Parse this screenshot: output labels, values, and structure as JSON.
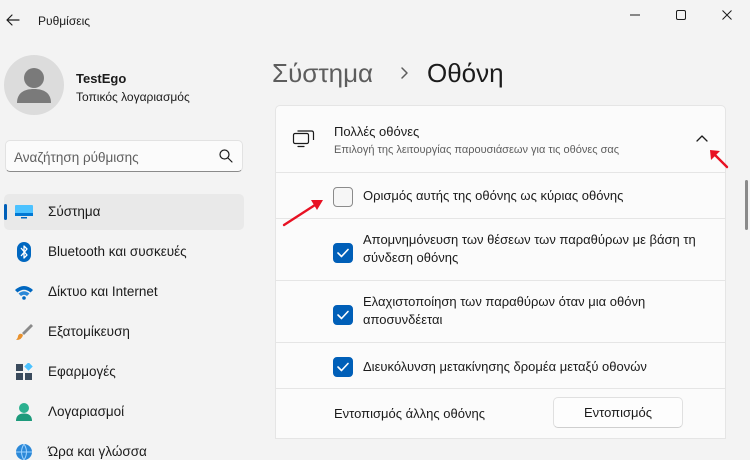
{
  "window": {
    "title": "Ρυθμίσεις"
  },
  "profile": {
    "name": "TestEgo",
    "account_type": "Τοπικός λογαριασμός"
  },
  "search": {
    "placeholder": "Αναζήτηση ρύθμισης"
  },
  "nav": {
    "items": [
      {
        "label": "Σύστημα",
        "icon": "system-monitor-icon",
        "selected": true
      },
      {
        "label": "Bluetooth και συσκευές",
        "icon": "bluetooth-icon",
        "selected": false
      },
      {
        "label": "Δίκτυο και Internet",
        "icon": "wifi-icon",
        "selected": false
      },
      {
        "label": "Εξατομίκευση",
        "icon": "paintbrush-icon",
        "selected": false
      },
      {
        "label": "Εφαρμογές",
        "icon": "apps-icon",
        "selected": false
      },
      {
        "label": "Λογαριασμοί",
        "icon": "account-icon",
        "selected": false
      },
      {
        "label": "Ώρα και γλώσσα",
        "icon": "globe-clock-icon",
        "selected": false
      }
    ]
  },
  "breadcrumb": {
    "parent": "Σύστημα",
    "current": "Οθόνη"
  },
  "multiple_displays": {
    "title": "Πολλές οθόνες",
    "subtitle": "Επιλογή της λειτουργίας παρουσιάσεων για τις οθόνες σας",
    "expanded": true,
    "options": [
      {
        "label": "Ορισμός αυτής της οθόνης ως κύριας οθόνης",
        "checked": false
      },
      {
        "label": "Απομνημόνευση των θέσεων των παραθύρων με βάση τη σύνδεση οθόνης",
        "checked": true
      },
      {
        "label": "Ελαχιστοποίηση των παραθύρων όταν μια οθόνη αποσυνδέεται",
        "checked": true
      },
      {
        "label": "Διευκόλυνση μετακίνησης δρομέα μεταξύ οθονών",
        "checked": true
      }
    ],
    "detect": {
      "label": "Εντοπισμός άλλης οθόνης",
      "button": "Εντοπισμός"
    }
  },
  "colors": {
    "accent": "#005fb8",
    "annotation_arrow": "#e81123",
    "background": "#f3f3f3",
    "card": "#fbfbfb"
  }
}
